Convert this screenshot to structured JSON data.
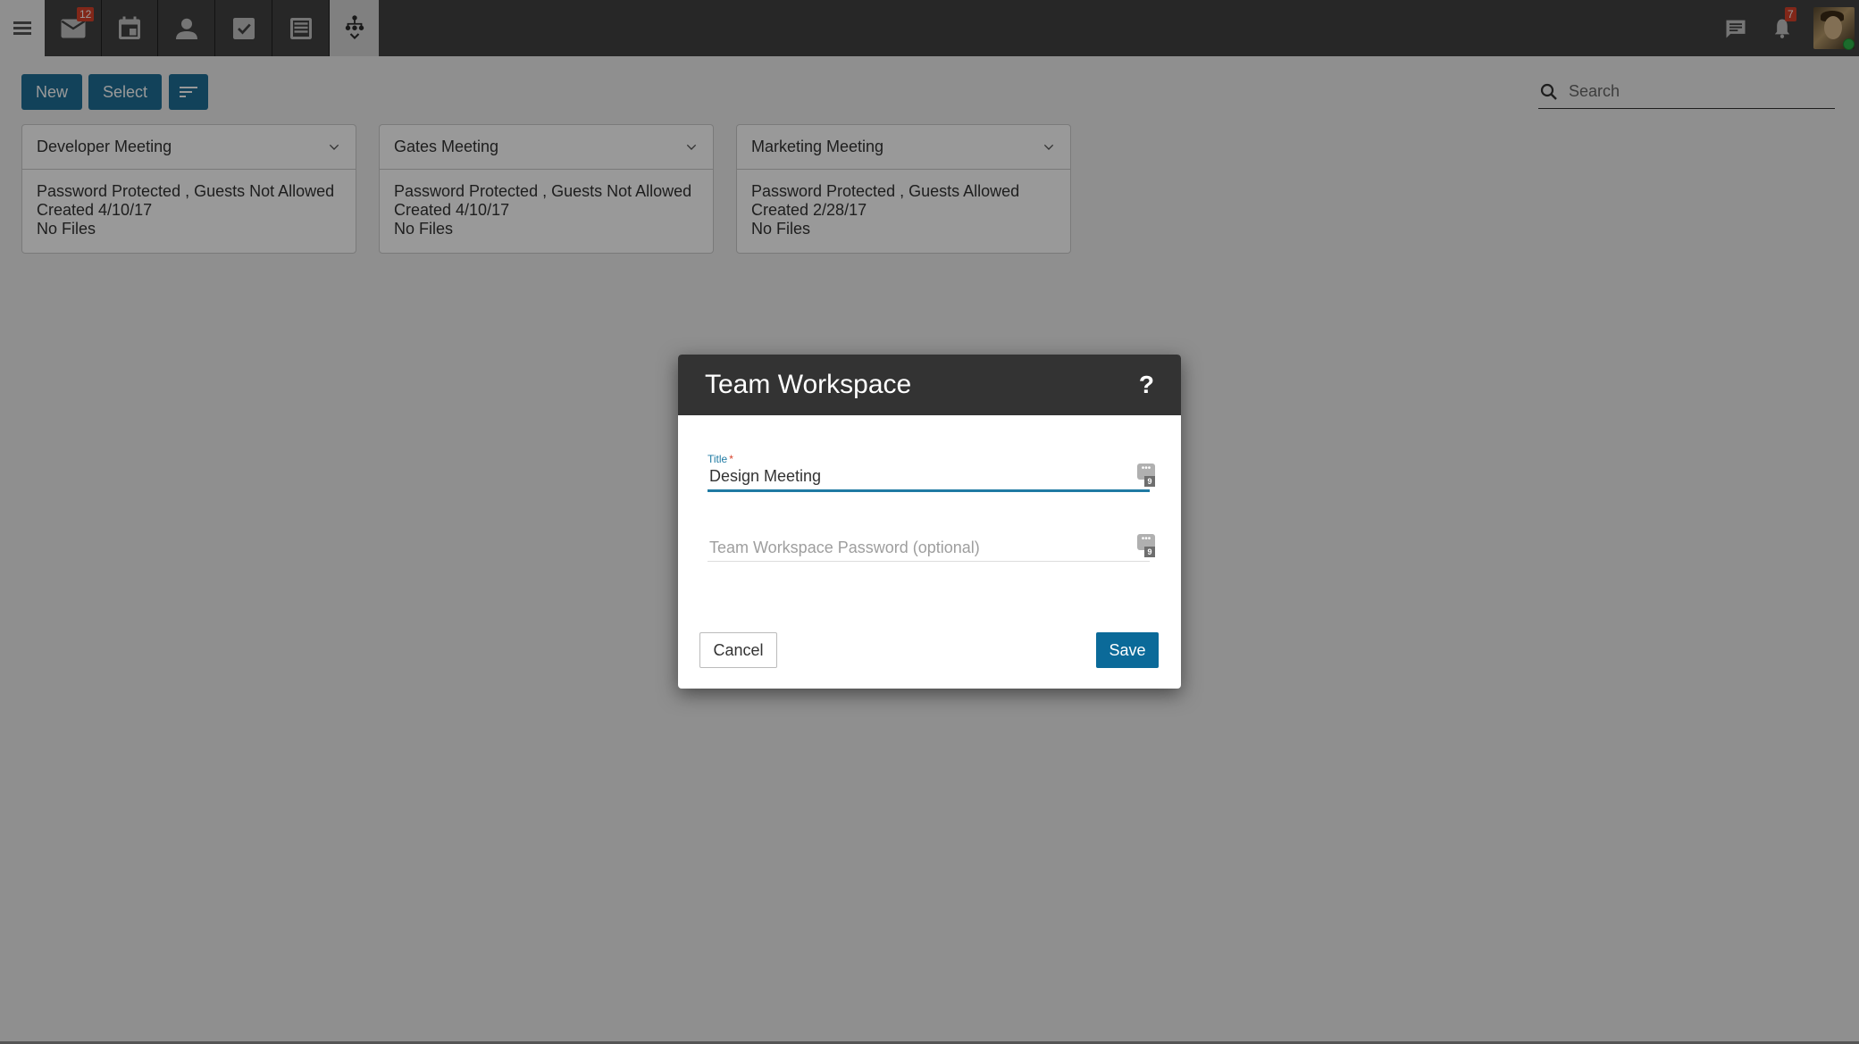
{
  "nav": {
    "menu_icon": "hamburger-icon",
    "tabs": [
      {
        "name": "mail",
        "icon": "mail-icon",
        "badge": "12"
      },
      {
        "name": "calendar",
        "icon": "calendar-icon"
      },
      {
        "name": "contacts",
        "icon": "person-icon"
      },
      {
        "name": "tasks",
        "icon": "checkbox-icon"
      },
      {
        "name": "notes",
        "icon": "notes-icon"
      },
      {
        "name": "team-workspace",
        "icon": "workspace-tree-icon",
        "active": true
      }
    ],
    "right": {
      "chat_icon": "chat-icon",
      "notifications_icon": "bell-icon",
      "notifications_badge": "7",
      "presence_status": "online"
    }
  },
  "toolbar": {
    "new_label": "New",
    "select_label": "Select",
    "sort_icon": "sort-icon",
    "search_placeholder": "Search"
  },
  "workspaces": [
    {
      "title": "Developer Meeting",
      "security": "Password Protected , Guests Not Allowed",
      "created": "Created 4/10/17",
      "files": "No Files"
    },
    {
      "title": "Gates Meeting",
      "security": "Password Protected , Guests Not Allowed",
      "created": "Created 4/10/17",
      "files": "No Files"
    },
    {
      "title": "Marketing Meeting",
      "security": "Password Protected , Guests Allowed",
      "created": "Created 2/28/17",
      "files": "No Files"
    }
  ],
  "dialog": {
    "title": "Team Workspace",
    "help": "?",
    "title_field": {
      "label": "Title",
      "required_mark": "*",
      "value": "Design Meeting"
    },
    "password_field": {
      "placeholder": "Team Workspace Password (optional)",
      "value": ""
    },
    "password_manager_badge": "9",
    "cancel_label": "Cancel",
    "save_label": "Save"
  },
  "colors": {
    "primary": "#1f6f96",
    "save": "#0b6a99",
    "nav_bg": "#424242",
    "dialog_header": "#333333",
    "badge": "#d8412a",
    "focus_underline": "#1f7aa3"
  }
}
